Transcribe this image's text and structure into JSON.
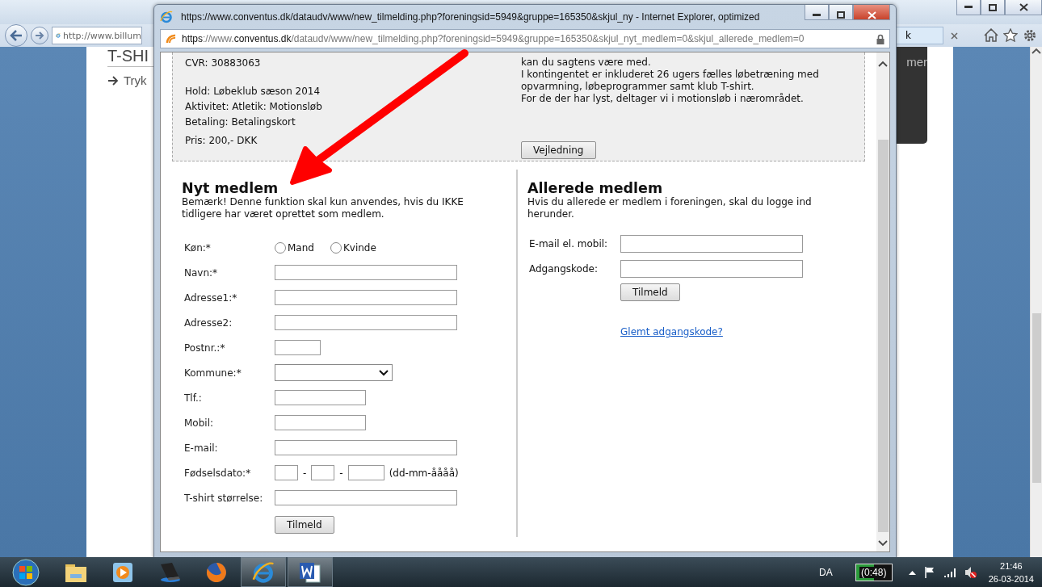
{
  "back_window": {
    "address": "http://www.billum",
    "tab_fragment": "k",
    "page": {
      "heading": "T-SHI",
      "link": "Tryk",
      "panel_text": "mer"
    }
  },
  "popup": {
    "title": "https://www.conventus.dk/dataudv/www/new_tilmelding.php?foreningsid=5949&gruppe=165350&skjul_ny - Internet Explorer, optimized",
    "address": [
      {
        "text": "https",
        "strong": true
      },
      {
        "text": "://www.",
        "strong": false
      },
      {
        "text": "conventus.dk",
        "strong": true
      },
      {
        "text": "/dataudv/www/new_tilmelding.php?foreningsid=5949&gruppe=165350&skjul_nyt_medlem=0&skjul_allerede_medlem=0",
        "strong": false
      }
    ],
    "info": {
      "left_groups": [
        [
          "CVR: 30883063"
        ],
        [
          "Hold: Løbeklub sæson 2014",
          "Aktivitet: Atletik: Motionsløb",
          "Betaling: Betalingskort"
        ],
        [
          "Pris: 200,- DKK"
        ]
      ],
      "right_lines": [
        "kan du sagtens være med.",
        "I kontingentet er inkluderet 26 ugers fælles løbetræning med",
        "opvarmning, løbeprogrammer samt klub T-shirt.",
        "For de der har lyst, deltager vi i motionsløb i nærområdet."
      ],
      "button": "Vejledning"
    },
    "new_member": {
      "heading": "Nyt medlem",
      "note": "Bemærk! Denne funktion skal kun anvendes, hvis du IKKE tidligere har været oprettet som medlem.",
      "fields": [
        {
          "kind": "radio",
          "label": "Køn:*",
          "options": [
            {
              "label": "Mand",
              "selected": false
            },
            {
              "label": "Kvinde",
              "selected": false
            }
          ]
        },
        {
          "kind": "longtext",
          "label": "Navn:*"
        },
        {
          "kind": "longtext",
          "label": "Adresse1:*"
        },
        {
          "kind": "longtext",
          "label": "Adresse2:"
        },
        {
          "kind": "shorttext",
          "label": "Postnr.:*"
        },
        {
          "kind": "select",
          "label": "Kommune:*"
        },
        {
          "kind": "midtext",
          "label": "Tlf.:"
        },
        {
          "kind": "midtext",
          "label": "Mobil:"
        },
        {
          "kind": "longtext",
          "label": "E-mail:"
        },
        {
          "kind": "date",
          "label": "Fødselsdato:*",
          "separators": [
            "-",
            "-"
          ],
          "hint": "(dd-mm-åååå)"
        },
        {
          "kind": "longtext",
          "label": "T-shirt størrelse:"
        }
      ],
      "submit": "Tilmeld"
    },
    "existing_member": {
      "heading": "Allerede medlem",
      "note": "Hvis du allerede er medlem i foreningen, skal du logge ind herunder.",
      "fields": [
        {
          "label": "E-mail el. mobil:"
        },
        {
          "label": "Adgangskode:"
        }
      ],
      "submit": "Tilmeld",
      "link": "Glemt adgangskode?"
    }
  },
  "taskbar": {
    "items": [
      {
        "kind": "folder",
        "active": false
      },
      {
        "kind": "media",
        "active": false
      },
      {
        "kind": "laptop",
        "active": false
      },
      {
        "kind": "firefox",
        "active": false
      },
      {
        "kind": "ie",
        "active": true
      },
      {
        "kind": "word",
        "active": true
      }
    ],
    "language": "DA",
    "battery": "(0:48)",
    "time": "21:46",
    "date": "26-03-2014"
  }
}
